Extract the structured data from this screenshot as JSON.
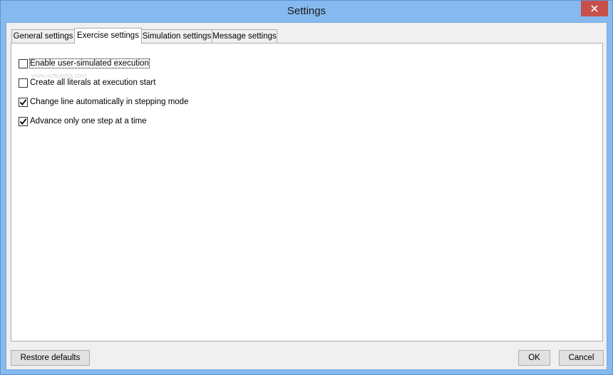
{
  "window": {
    "title": "Settings"
  },
  "tabs": [
    {
      "label": "General settings",
      "active": false
    },
    {
      "label": "Exercise settings",
      "active": true
    },
    {
      "label": "Simulation settings",
      "active": false
    },
    {
      "label": "Message settings",
      "active": false
    }
  ],
  "options": [
    {
      "label": "Enable user-simulated execution",
      "checked": false,
      "focused": true
    },
    {
      "label": "Create all literals at execution start",
      "checked": false,
      "focused": false
    },
    {
      "label": "Change line automatically in stepping mode",
      "checked": true,
      "focused": false
    },
    {
      "label": "Advance only one step at a time",
      "checked": true,
      "focused": false
    }
  ],
  "watermark": "www.softpedia.com",
  "buttons": {
    "restore": "Restore defaults",
    "ok": "OK",
    "cancel": "Cancel"
  },
  "colors": {
    "frame": "#86b9f0",
    "close_button": "#c7514a",
    "panel": "#ffffff",
    "client": "#f0f0f0"
  },
  "icons": {
    "close": "close-icon",
    "check": "checkmark-icon"
  }
}
